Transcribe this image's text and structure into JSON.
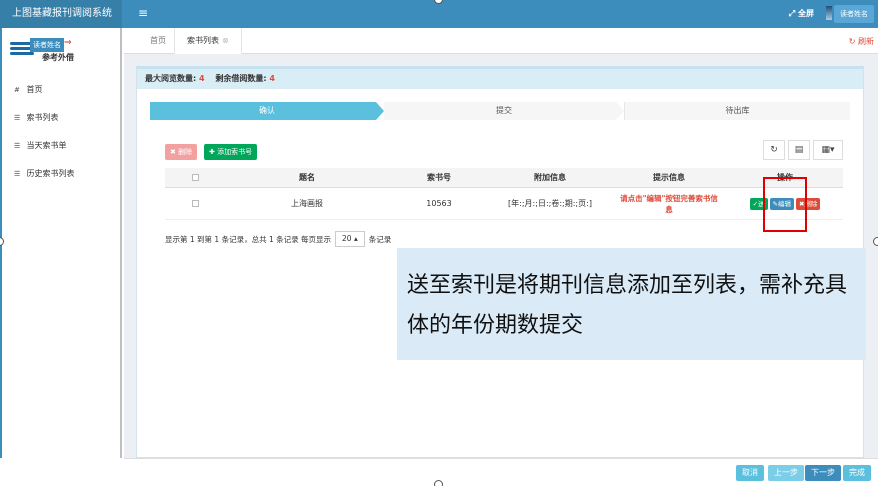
{
  "app": {
    "title": "上图基藏报刊调阅系统",
    "menu_icon": "≡"
  },
  "topbar": {
    "fullscreen_label": "全屏",
    "user_label": "读者姓名"
  },
  "sidebar": {
    "logo_badge": "读者姓名",
    "logo_sub": "参考外借",
    "items": [
      {
        "icon": "home-icon",
        "glyph": "#",
        "label": "首页"
      },
      {
        "icon": "list-icon",
        "glyph": "☰",
        "label": "索书列表"
      },
      {
        "icon": "list-icon",
        "glyph": "☰",
        "label": "当天索书单"
      },
      {
        "icon": "list-icon",
        "glyph": "☰",
        "label": "历史索书列表"
      }
    ]
  },
  "tabs": {
    "home": "首页",
    "active": "索书列表",
    "refresh": "刷新"
  },
  "panel": {
    "max_label": "最大阅览数量:",
    "max_value": "4",
    "remain_label": "剩余借阅数量:",
    "remain_value": "4"
  },
  "steps": [
    "确认",
    "提交",
    "待出库"
  ],
  "toolbar": {
    "delete_label": "删除",
    "add_label": "添加索书号"
  },
  "table": {
    "headers": [
      "题名",
      "索书号",
      "附加信息",
      "提示信息",
      "操作"
    ],
    "rows": [
      {
        "title": "上海画报",
        "call_number": "10563",
        "extra": "[年:;月:;日:;卷:;期:;页:]",
        "hint_line1": "请点击\"编辑\"按钮完善索书信",
        "hint_line2": "息",
        "actions": {
          "send": "送",
          "edit": "编辑",
          "delete": "删除"
        }
      }
    ]
  },
  "pager": {
    "summary": "显示第 1 到第 1 条记录，总共 1 条记录",
    "per_page_prefix": "每页显示",
    "per_page_value": "20",
    "per_page_suffix": "条记录"
  },
  "caption": "送至索刊是将期刊信息添加至列表，需补充具体的年份期数提交",
  "footer": {
    "cancel": "取消",
    "prev": "上一步",
    "next": "下一步",
    "done": "完成"
  },
  "colors": {
    "primary": "#3c8dbc",
    "success": "#00a65a",
    "danger": "#dd4b39",
    "info": "#5bc0de"
  }
}
